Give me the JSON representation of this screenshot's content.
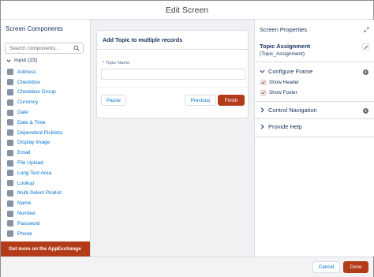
{
  "window": {
    "title": "Edit Screen"
  },
  "left_panel": {
    "header": "Screen Components",
    "search_placeholder": "Search components...",
    "section_label": "Input (23)",
    "components": [
      "Address",
      "Checkbox",
      "Checkbox Group",
      "Currency",
      "Date",
      "Date & Time",
      "Dependent Picklists",
      "Display Image",
      "Email",
      "File Upload",
      "Long Text Area",
      "Lookup",
      "Multi-Select Picklist",
      "Name",
      "Number",
      "Password",
      "Phone"
    ],
    "appexchange_label": "Get more on the AppExchange"
  },
  "canvas": {
    "card_title": "Add Topic to multiple records",
    "field_label": "Topic Name",
    "required_marker": "*",
    "pause_label": "Pause",
    "previous_label": "Previous",
    "finish_label": "Finish"
  },
  "right_panel": {
    "header": "Screen Properties",
    "screen_name": "Topic Assignment",
    "screen_api_name": "(Topic_Assignment)",
    "configure_frame_label": "Configure Frame",
    "show_header_label": "Show Header",
    "show_header_checked": true,
    "show_footer_label": "Show Footer",
    "show_footer_checked": true,
    "control_navigation_label": "Control Navigation",
    "provide_help_label": "Provide Help"
  },
  "footer": {
    "cancel_label": "Cancel",
    "done_label": "Done"
  },
  "colors": {
    "brand": "#b23b1a",
    "link": "#0070d2",
    "text": "#16325c",
    "border": "#d8dde6",
    "canvas_bg": "#f0f1f3"
  }
}
